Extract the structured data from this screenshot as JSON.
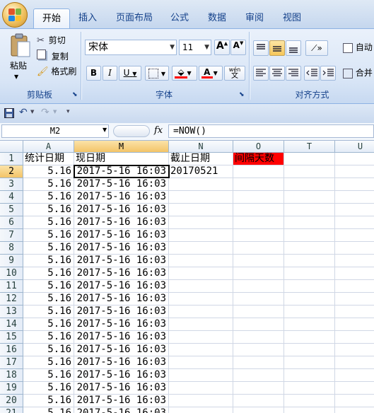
{
  "ribbon": {
    "tabs": [
      "开始",
      "插入",
      "页面布局",
      "公式",
      "数据",
      "审阅",
      "视图"
    ],
    "clipboard": {
      "paste": "粘贴",
      "cut": "剪切",
      "copy": "复制",
      "format_painter": "格式刷",
      "title": "剪贴板"
    },
    "font": {
      "name": "宋体",
      "size": "11",
      "grow": "A",
      "shrink": "A",
      "bold": "B",
      "italic": "I",
      "underline": "U",
      "title": "字体",
      "phonetic": "wén"
    },
    "alignment": {
      "wrap": "自动",
      "merge": "合并",
      "title": "对齐方式"
    }
  },
  "formula_bar": {
    "name_box": "M2",
    "fx": "fx",
    "formula": "=NOW()"
  },
  "sheet": {
    "columns": [
      "A",
      "M",
      "N",
      "O",
      "T",
      "U"
    ],
    "selected_column": "M",
    "selected_row": "2",
    "header_row": [
      "统计日期",
      "现日期",
      "截止日期",
      "间隔天数"
    ],
    "highlight_color": "#ff0000",
    "rows": [
      {
        "n": "2",
        "a": "5.16",
        "m": "2017-5-16 16:03",
        "nval": "20170521"
      },
      {
        "n": "3",
        "a": "5.16",
        "m": "2017-5-16 16:03"
      },
      {
        "n": "4",
        "a": "5.16",
        "m": "2017-5-16 16:03"
      },
      {
        "n": "5",
        "a": "5.16",
        "m": "2017-5-16 16:03"
      },
      {
        "n": "6",
        "a": "5.16",
        "m": "2017-5-16 16:03"
      },
      {
        "n": "7",
        "a": "5.16",
        "m": "2017-5-16 16:03"
      },
      {
        "n": "8",
        "a": "5.16",
        "m": "2017-5-16 16:03"
      },
      {
        "n": "9",
        "a": "5.16",
        "m": "2017-5-16 16:03"
      },
      {
        "n": "10",
        "a": "5.16",
        "m": "2017-5-16 16:03"
      },
      {
        "n": "11",
        "a": "5.16",
        "m": "2017-5-16 16:03"
      },
      {
        "n": "12",
        "a": "5.16",
        "m": "2017-5-16 16:03"
      },
      {
        "n": "13",
        "a": "5.16",
        "m": "2017-5-16 16:03"
      },
      {
        "n": "14",
        "a": "5.16",
        "m": "2017-5-16 16:03"
      },
      {
        "n": "15",
        "a": "5.16",
        "m": "2017-5-16 16:03"
      },
      {
        "n": "16",
        "a": "5.16",
        "m": "2017-5-16 16:03"
      },
      {
        "n": "17",
        "a": "5.16",
        "m": "2017-5-16 16:03"
      },
      {
        "n": "18",
        "a": "5.16",
        "m": "2017-5-16 16:03"
      },
      {
        "n": "19",
        "a": "5.16",
        "m": "2017-5-16 16:03"
      },
      {
        "n": "20",
        "a": "5.16",
        "m": "2017-5-16 16:03"
      },
      {
        "n": "21",
        "a": "5.16",
        "m": "2017-5-16 16:03"
      }
    ]
  }
}
